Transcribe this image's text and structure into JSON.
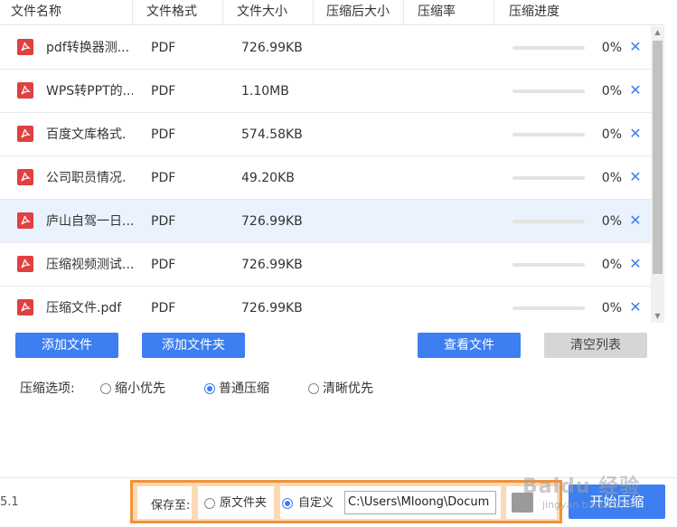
{
  "table": {
    "headers": [
      "文件名称",
      "文件格式",
      "文件大小",
      "压缩后大小",
      "压缩率",
      "压缩进度"
    ],
    "rows": [
      {
        "name": "pdf转换器测...",
        "format": "PDF",
        "size": "726.99KB",
        "progress": 0,
        "pct": "0%"
      },
      {
        "name": "WPS转PPT的...",
        "format": "PDF",
        "size": "1.10MB",
        "progress": 0,
        "pct": "0%"
      },
      {
        "name": "百度文库格式.",
        "format": "PDF",
        "size": "574.58KB",
        "progress": 0,
        "pct": "0%"
      },
      {
        "name": "公司职员情况.",
        "format": "PDF",
        "size": "49.20KB",
        "progress": 0,
        "pct": "0%"
      },
      {
        "name": "庐山自驾一日...",
        "format": "PDF",
        "size": "726.99KB",
        "progress": 0,
        "pct": "0%"
      },
      {
        "name": "压缩视频测试...",
        "format": "PDF",
        "size": "726.99KB",
        "progress": 0,
        "pct": "0%"
      },
      {
        "name": "压缩文件.pdf",
        "format": "PDF",
        "size": "726.99KB",
        "progress": 0,
        "pct": "0%"
      }
    ],
    "selected_row": 4,
    "delete_glyph": "✕"
  },
  "buttons": {
    "add_file": "添加文件",
    "add_folder": "添加文件夹",
    "view_files": "查看文件",
    "clear_list": "清空列表"
  },
  "options": {
    "label": "压缩选项:",
    "choices": [
      "缩小优先",
      "普通压缩",
      "清晰优先"
    ],
    "selected": 1
  },
  "footer": {
    "version": "5.1",
    "save_to": "保存至:",
    "original_folder": "原文件夹",
    "custom": "自定义",
    "save_selected": "custom",
    "path": "C:\\Users\\Mloong\\Docum",
    "start": "开始压缩",
    "watermark": "Baidu 经验",
    "watermark_sub": "jingyan.baidu.com"
  },
  "colors": {
    "accent": "#3d7ef0",
    "highlight_border": "#f0923a",
    "pdf_icon": "#e04040",
    "selected_row": "#eaf2fd"
  }
}
